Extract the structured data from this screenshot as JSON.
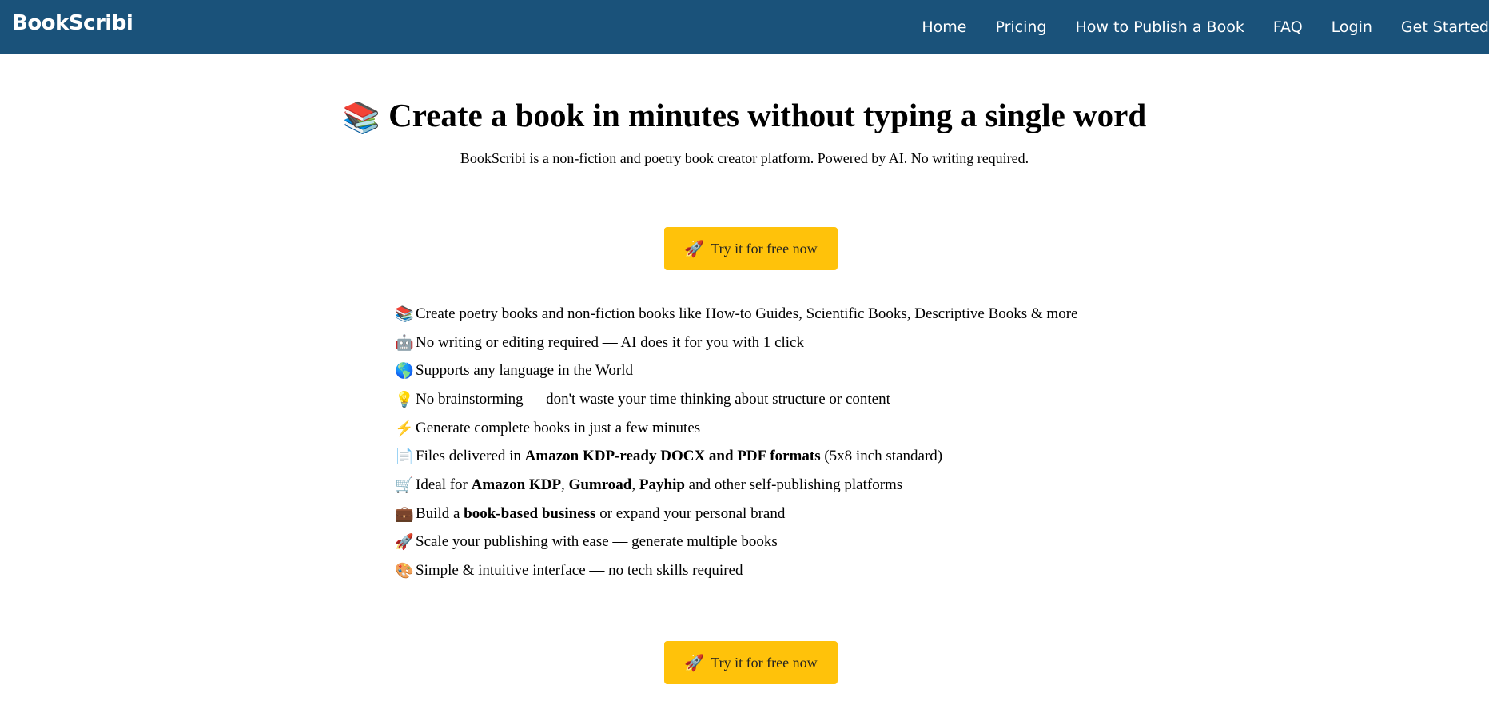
{
  "brand": "BookScribi",
  "nav": {
    "items": [
      {
        "label": "Home"
      },
      {
        "label": "Pricing"
      },
      {
        "label": "How to Publish a Book"
      },
      {
        "label": "FAQ"
      },
      {
        "label": "Login"
      },
      {
        "label": "Get Started"
      }
    ]
  },
  "hero": {
    "emoji": "📚",
    "title": "Create a book in minutes without typing a single word",
    "subtitle": "BookScribi is a non-fiction and poetry book creator platform. Powered by AI. No writing required."
  },
  "cta": {
    "icon": "🚀",
    "label": "Try it for free now"
  },
  "features": [
    {
      "icon": "📚",
      "parts": [
        {
          "t": "Create poetry books and non-fiction books like How-to Guides, Scientific Books, Descriptive Books & more"
        }
      ]
    },
    {
      "icon": "🤖",
      "parts": [
        {
          "t": "No writing or editing required — AI does it for you with 1 click"
        }
      ]
    },
    {
      "icon": "🌎",
      "parts": [
        {
          "t": "Supports any language in the World"
        }
      ]
    },
    {
      "icon": "💡",
      "parts": [
        {
          "t": "No brainstorming — don't waste your time thinking about structure or content"
        }
      ]
    },
    {
      "icon": "⚡",
      "parts": [
        {
          "t": "Generate complete books in just a few minutes"
        }
      ]
    },
    {
      "icon": "📄",
      "parts": [
        {
          "t": "Files delivered in "
        },
        {
          "t": "Amazon KDP-ready DOCX and PDF formats",
          "b": true
        },
        {
          "t": " (5x8 inch standard)"
        }
      ]
    },
    {
      "icon": "🛒",
      "parts": [
        {
          "t": "Ideal for "
        },
        {
          "t": "Amazon KDP",
          "b": true
        },
        {
          "t": ", "
        },
        {
          "t": "Gumroad",
          "b": true
        },
        {
          "t": ", "
        },
        {
          "t": "Payhip",
          "b": true
        },
        {
          "t": " and other self-publishing platforms"
        }
      ]
    },
    {
      "icon": "💼",
      "parts": [
        {
          "t": "Build a "
        },
        {
          "t": "book-based business",
          "b": true
        },
        {
          "t": " or expand your personal brand"
        }
      ]
    },
    {
      "icon": "🚀",
      "parts": [
        {
          "t": "Scale your publishing with ease — generate multiple books"
        }
      ]
    },
    {
      "icon": "🎨",
      "parts": [
        {
          "t": "Simple & intuitive interface — no tech skills required"
        }
      ]
    }
  ],
  "icons": {
    "hero": "books-icon",
    "cta": "rocket-icon",
    "features": [
      "books-icon",
      "robot-icon",
      "globe-icon",
      "lightbulb-icon",
      "lightning-icon",
      "document-icon",
      "shopping-cart-icon",
      "briefcase-icon",
      "rocket-icon",
      "palette-icon"
    ]
  },
  "colors": {
    "navbar": "#1a527a",
    "cta": "#ffc20a"
  }
}
